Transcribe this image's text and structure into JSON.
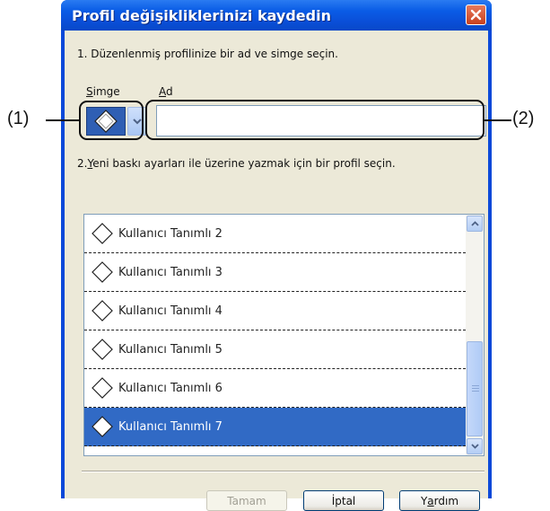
{
  "window": {
    "title": "Profil değişikliklerinizi kaydedin"
  },
  "step1": "1. Düzenlenmiş profilinize bir ad ve simge seçin.",
  "icon_field": {
    "label_accel": "S",
    "label_rest": "imge",
    "icon": "diamond-profile-icon",
    "dropdown_icon": "chevron-down-icon"
  },
  "name_field": {
    "label_accel": "A",
    "label_rest": "d",
    "value": ""
  },
  "step2": {
    "prefix": "2.",
    "accel": "Y",
    "rest": "eni baskı ayarları ile üzerine yazmak için bir profil seçin."
  },
  "profiles": [
    {
      "label": "Kullanıcı Tanımlı 2",
      "selected": false
    },
    {
      "label": "Kullanıcı Tanımlı 3",
      "selected": false
    },
    {
      "label": "Kullanıcı Tanımlı 4",
      "selected": false
    },
    {
      "label": "Kullanıcı Tanımlı 5",
      "selected": false
    },
    {
      "label": "Kullanıcı Tanımlı 6",
      "selected": false
    },
    {
      "label": "Kullanıcı Tanımlı 7",
      "selected": true
    }
  ],
  "buttons": {
    "ok": "Tamam",
    "cancel": "İptal",
    "help_pre": "Y",
    "help_accel": "a",
    "help_post": "rdım"
  },
  "callouts": {
    "left": "(1)",
    "right": "(2)"
  },
  "colors": {
    "title_bar": "#0a5ce6",
    "selection": "#316ac5",
    "dialog_bg": "#ece9d8"
  }
}
